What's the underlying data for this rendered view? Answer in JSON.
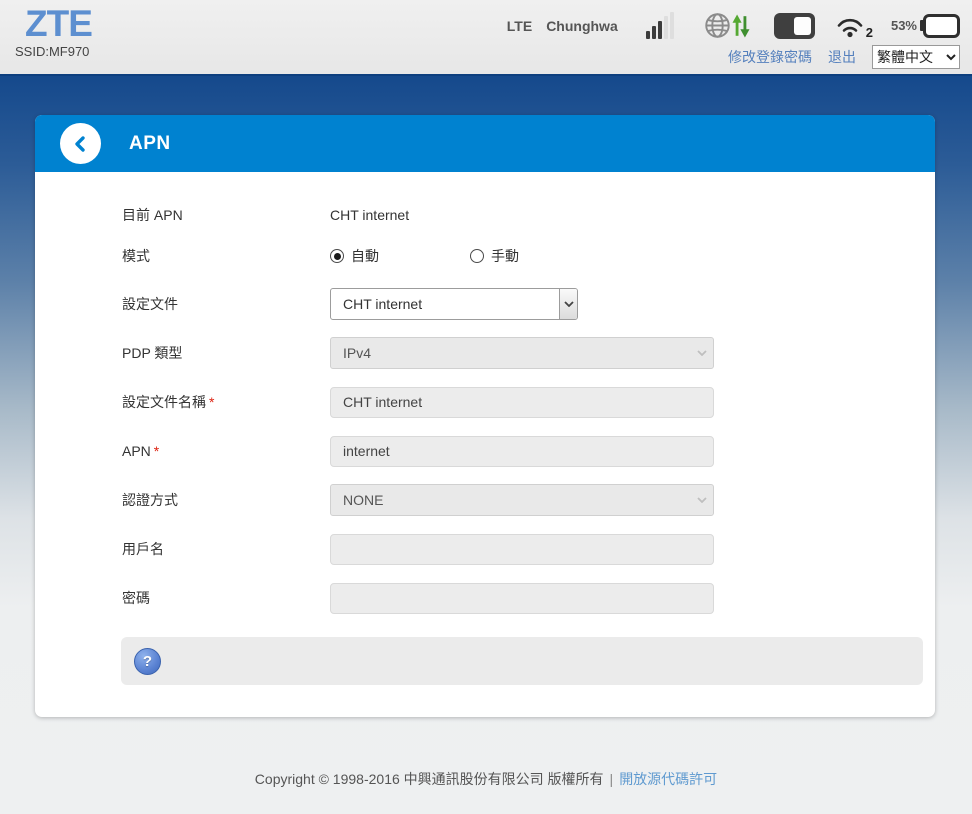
{
  "header": {
    "logo": "ZTE",
    "ssid": "SSID:MF970",
    "network_type": "LTE",
    "carrier": "Chunghwa",
    "wifi_client_count": "2",
    "battery_percent": "53%",
    "change_password_link": "修改登錄密碼",
    "logout_link": "退出",
    "language_selected": "繁體中文"
  },
  "banner": {
    "title": "APN"
  },
  "form": {
    "current_apn": {
      "label": "目前 APN",
      "value": "CHT internet"
    },
    "mode": {
      "label": "模式",
      "options": [
        {
          "label": "自動",
          "selected": true
        },
        {
          "label": "手動",
          "selected": false
        }
      ]
    },
    "profile": {
      "label": "設定文件",
      "value": "CHT internet"
    },
    "pdp_type": {
      "label": "PDP 類型",
      "value": "IPv4"
    },
    "profile_name": {
      "label": "設定文件名稱",
      "required_mark": "*",
      "value": "CHT internet"
    },
    "apn": {
      "label": "APN",
      "required_mark": "*",
      "value": "internet"
    },
    "auth_mode": {
      "label": "認證方式",
      "value": "NONE"
    },
    "username": {
      "label": "用戶名",
      "value": ""
    },
    "password": {
      "label": "密碼",
      "value": ""
    }
  },
  "help": {
    "icon_label": "?"
  },
  "footer": {
    "copyright": "Copyright © 1998-2016 中興通訊股份有限公司 版權所有",
    "separator": "|",
    "license_link": "開放源代碼許可"
  },
  "colors": {
    "banner_blue": "#0082d0",
    "logo_blue": "#5d8fd0",
    "header_link_blue": "#5580bd",
    "footer_link_blue": "#5f9ad0",
    "arrow_green_up": "#55a832",
    "arrow_green_down": "#3f8f2f"
  }
}
